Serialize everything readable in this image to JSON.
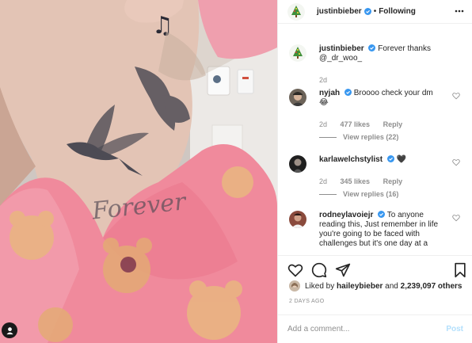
{
  "post": {
    "author": "justinbieber",
    "follow_state": "Following",
    "separator": "•",
    "caption": {
      "user": "justinbieber",
      "text": "Forever thanks",
      "mention": "@_dr_woo_",
      "time": "2d"
    },
    "image": {
      "tattoo_text": "Forever",
      "description_icon": "neck-tattoo-photo"
    },
    "comments": [
      {
        "user": "nyjah",
        "verified": true,
        "text": "Broooo check your dm",
        "emoji": "😂",
        "time": "2d",
        "likes": "477 likes",
        "reply": "Reply",
        "view_replies": "View replies (22)"
      },
      {
        "user": "karlawelchstylist",
        "verified": true,
        "text": "",
        "emoji": "🖤",
        "time": "2d",
        "likes": "345 likes",
        "reply": "Reply",
        "view_replies": "View replies (16)"
      },
      {
        "user": "rodneylavoiejr",
        "verified": true,
        "text": "To anyone reading this, Just remember in life you're going to be faced with challenges but it's one day at a"
      }
    ],
    "likes": {
      "prefix": "Liked by",
      "first_user": "haileybieber",
      "middle": "and",
      "count": "2,239,097 others"
    },
    "time_ago": "2 DAYS AGO",
    "add_comment": {
      "placeholder": "Add a comment...",
      "post_label": "Post"
    },
    "colors": {
      "verified": "#3897f0",
      "meta": "#8e8e8e",
      "post_button": "#b2dffc",
      "shirt": "#f08a9c"
    }
  }
}
